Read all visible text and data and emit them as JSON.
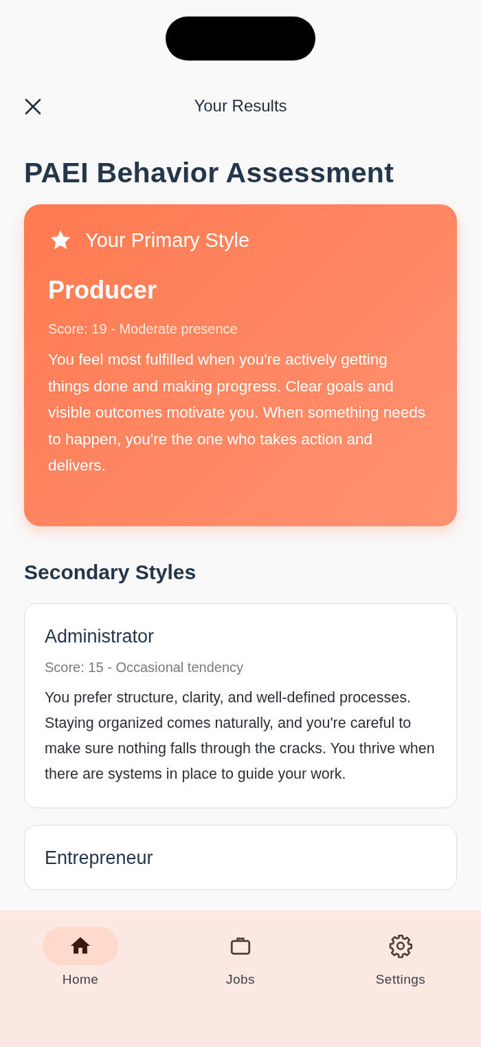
{
  "header": {
    "title": "Your Results"
  },
  "page_title": "PAEI Behavior Assessment",
  "primary": {
    "heading": "Your Primary Style",
    "name": "Producer",
    "score": "Score: 19 - Moderate presence",
    "description": "You feel most fulfilled when you're actively getting things done and making progress. Clear goals and visible outcomes motivate you. When something needs to happen, you're the one who takes action and delivers."
  },
  "secondary": {
    "heading": "Secondary Styles",
    "styles": [
      {
        "name": "Administrator",
        "score": "Score: 15 - Occasional tendency",
        "description": "You prefer structure, clarity, and well-defined processes. Staying organized comes naturally, and you're careful to make sure nothing falls through the cracks. You thrive when there are systems in place to guide your work."
      },
      {
        "name": "Entrepreneur"
      }
    ]
  },
  "nav": [
    {
      "label": "Home",
      "kind": "home",
      "selected": true
    },
    {
      "label": "Jobs",
      "kind": "jobs",
      "selected": false
    },
    {
      "label": "Settings",
      "kind": "settings",
      "selected": false
    }
  ]
}
